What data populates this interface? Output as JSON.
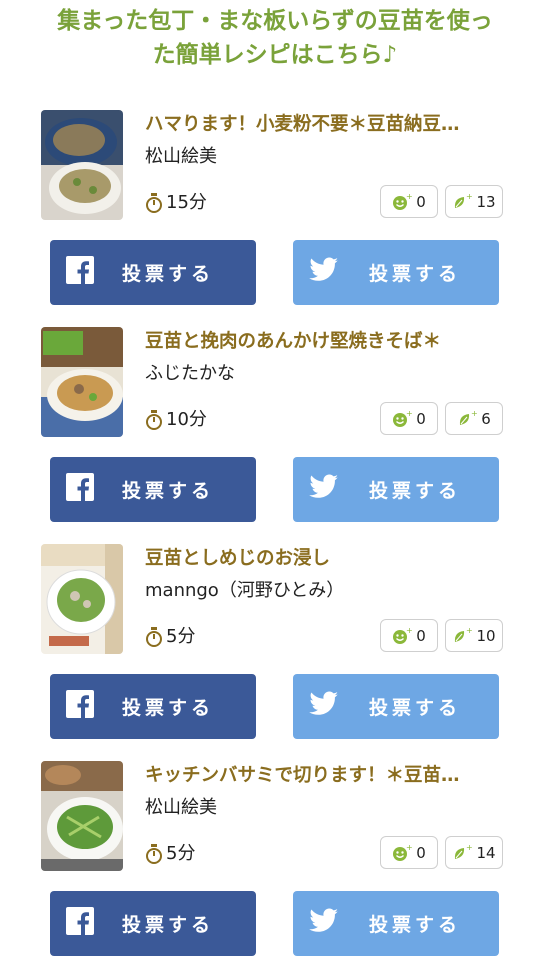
{
  "header": {
    "line1": "集まった包丁・まな板いらずの豆苗を使っ",
    "line2": "た簡単レシピはこちら♪"
  },
  "colors": {
    "heading_green": "#7aa23a",
    "title_brown": "#8a6d1f",
    "facebook_blue": "#3b5998",
    "twitter_blue": "#6ea7e4"
  },
  "vote_labels": {
    "facebook": "投票する",
    "twitter": "投票する"
  },
  "recipes": [
    {
      "title": "ハマります！小麦粉不要＊豆苗納豆…",
      "author": "松山絵美",
      "time": "15分",
      "smile_count": "0",
      "leaf_count": "13"
    },
    {
      "title": "豆苗と挽肉のあんかけ堅焼きそば＊",
      "author": "ふじたかな",
      "time": "10分",
      "smile_count": "0",
      "leaf_count": "6"
    },
    {
      "title": "豆苗としめじのお浸し",
      "author": "manngo（河野ひとみ）",
      "time": "5分",
      "smile_count": "0",
      "leaf_count": "10"
    },
    {
      "title": "キッチンバサミで切ります！＊豆苗…",
      "author": "松山絵美",
      "time": "5分",
      "smile_count": "0",
      "leaf_count": "14"
    }
  ]
}
